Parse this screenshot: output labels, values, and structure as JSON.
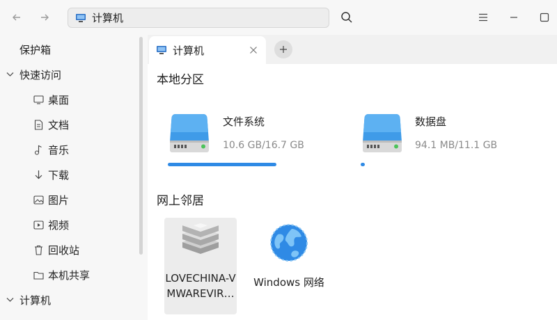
{
  "toolbar": {
    "address": "计算机"
  },
  "sidebar": {
    "vault": "保护箱",
    "quick_access": "快速访问",
    "items": [
      {
        "label": "桌面"
      },
      {
        "label": "文档"
      },
      {
        "label": "音乐"
      },
      {
        "label": "下载"
      },
      {
        "label": "图片"
      },
      {
        "label": "视频"
      },
      {
        "label": "回收站"
      },
      {
        "label": "本机共享"
      }
    ],
    "computer": "计算机"
  },
  "tabs": [
    {
      "label": "计算机"
    }
  ],
  "sections": {
    "local": "本地分区",
    "network": "网上邻居"
  },
  "disks": [
    {
      "name": "文件系统",
      "size": "10.6 GB/16.7 GB",
      "usage": 0.635
    },
    {
      "name": "数据盘",
      "size": "94.1 MB/11.1 GB",
      "usage": 0.008
    }
  ],
  "network": [
    {
      "label_line1": "LOVECHINA-V",
      "label_line2": "MWAREVIR…"
    },
    {
      "label_line1": "Windows 网络"
    }
  ],
  "colors": {
    "accent": "#2f8ae5",
    "drive": "#3f9be8"
  }
}
